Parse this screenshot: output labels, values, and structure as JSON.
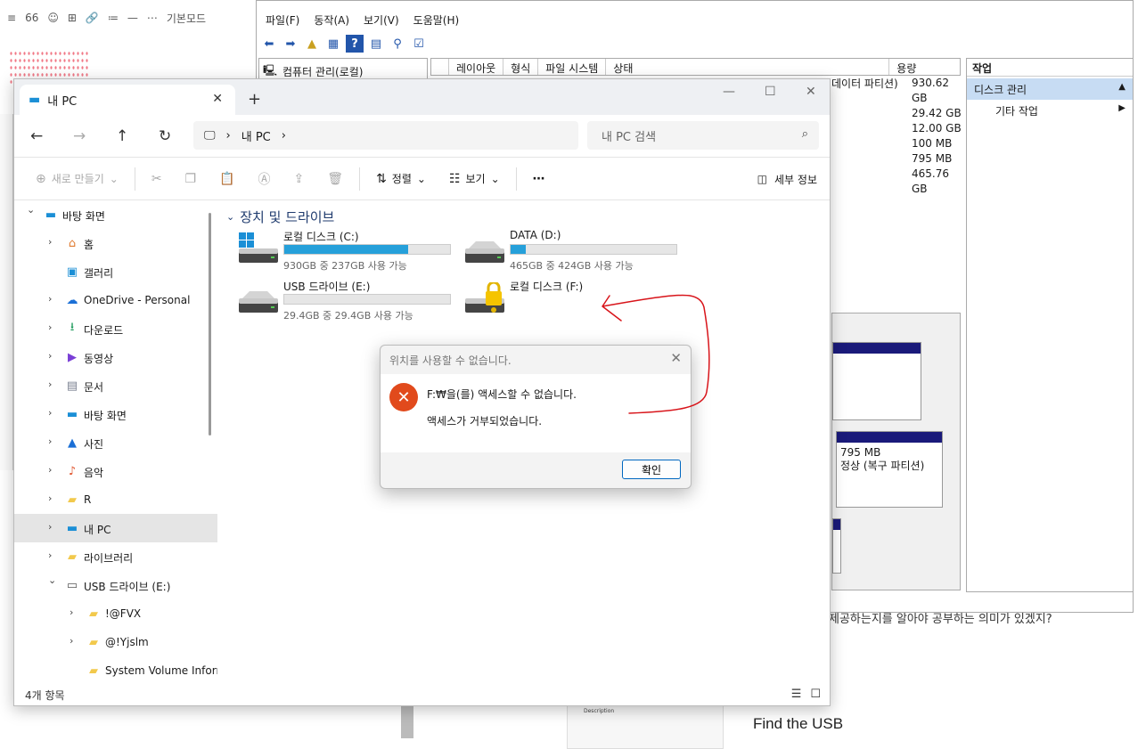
{
  "bg_editor": {
    "toolbar": [
      "≡",
      "66",
      "☺",
      "⊞",
      "🔗",
      "≔",
      "—",
      "⋯",
      "기본모드"
    ],
    "bottom_heading": "Find the USB",
    "bottom_text": "제공하는지를 알아야 공부하는 의미가 있겠지?",
    "thumb_title": "Description"
  },
  "computer_management": {
    "menu": [
      "파일(F)",
      "동작(A)",
      "보기(V)",
      "도움말(H)"
    ],
    "tree_root": "컴퓨터 관리(로컬)",
    "columns": [
      "레이아웃",
      "형식",
      "파일 시스템",
      "상태",
      "용량"
    ],
    "partition_desc": "데이터 파티션)",
    "sizes": [
      "930.62 GB",
      "29.42 GB",
      "12.00 GB",
      "100 MB",
      "795 MB",
      "465.76 GB"
    ],
    "actions_header": "작업",
    "action_selected": "디스크 관리",
    "action_sub": "기타 작업",
    "volume_size": "795 MB",
    "volume_status": "정상 (복구 파티션)"
  },
  "explorer": {
    "tab_title": "내 PC",
    "breadcrumb": "내 PC",
    "search_placeholder": "내 PC 검색",
    "commands": {
      "new": "새로 만들기",
      "sort": "정렬",
      "view": "보기",
      "more": "⋯",
      "details": "세부 정보"
    },
    "sidebar": [
      {
        "label": "바탕 화면",
        "icon": "desktop-icon",
        "glyph": "▬",
        "color": "#1b8fd6",
        "expanded": true,
        "indent": 0
      },
      {
        "label": "홈",
        "icon": "home-icon",
        "glyph": "⌂",
        "color": "#e07a2e",
        "indent": 1
      },
      {
        "label": "갤러리",
        "icon": "gallery-icon",
        "glyph": "▣",
        "color": "#1b8fd6",
        "indent": 1,
        "nochev": true
      },
      {
        "label": "OneDrive - Personal",
        "icon": "cloud-icon",
        "glyph": "☁",
        "color": "#1b6fd6",
        "indent": 1
      },
      {
        "label": "다운로드",
        "icon": "download-icon",
        "glyph": "⭳",
        "color": "#1b9a5a",
        "indent": 1
      },
      {
        "label": "동영상",
        "icon": "video-icon",
        "glyph": "▶",
        "color": "#7a3fd6",
        "indent": 1
      },
      {
        "label": "문서",
        "icon": "document-icon",
        "glyph": "▤",
        "color": "#7a8090",
        "indent": 1
      },
      {
        "label": "바탕 화면",
        "icon": "desktop-icon",
        "glyph": "▬",
        "color": "#1b8fd6",
        "indent": 1
      },
      {
        "label": "사진",
        "icon": "photo-icon",
        "glyph": "▲",
        "color": "#1b6fd6",
        "indent": 1
      },
      {
        "label": "음악",
        "icon": "music-icon",
        "glyph": "♪",
        "color": "#e0552e",
        "indent": 1
      },
      {
        "label": "R",
        "icon": "folder-icon",
        "glyph": "▰",
        "color": "#f2c94c",
        "indent": 1
      },
      {
        "label": "내 PC",
        "icon": "pc-icon",
        "glyph": "▬",
        "color": "#1b8fd6",
        "indent": 1,
        "selected": true
      },
      {
        "label": "라이브러리",
        "icon": "library-icon",
        "glyph": "▰",
        "color": "#f2c94c",
        "indent": 1
      },
      {
        "label": "USB 드라이브 (E:)",
        "icon": "usb-drive-icon",
        "glyph": "▭",
        "color": "#555",
        "indent": 1,
        "expanded": true
      },
      {
        "label": "!@FVX",
        "icon": "folder-icon",
        "glyph": "▰",
        "color": "#f2c94c",
        "indent": 2
      },
      {
        "label": "@!Yjslm",
        "icon": "folder-icon",
        "glyph": "▰",
        "color": "#f2c94c",
        "indent": 2
      },
      {
        "label": "System Volume Informati",
        "icon": "folder-icon",
        "glyph": "▰",
        "color": "#f2c94c",
        "indent": 2,
        "nochev": true
      }
    ],
    "group_title": "장치 및 드라이브",
    "drives": [
      {
        "name": "로컬 디스크 (C:)",
        "free": "930GB 중 237GB 사용 가능",
        "used_fraction": 0.745,
        "windows": true
      },
      {
        "name": "DATA (D:)",
        "free": "465GB 중 424GB 사용 가능",
        "used_fraction": 0.09
      },
      {
        "name": "USB 드라이브 (E:)",
        "free": "29.4GB 중 29.4GB 사용 가능",
        "used_fraction": 0.0
      },
      {
        "name": "로컬 디스크 (F:)",
        "locked": true
      }
    ],
    "status": "4개 항목"
  },
  "dialog": {
    "title": "위치를 사용할 수 없습니다.",
    "message": "F:₩을(를) 액세스할 수 없습니다.",
    "detail": "액세스가 거부되었습니다.",
    "ok": "확인"
  },
  "colors": {
    "accent": "#26a0da",
    "annotation": "#d8141a",
    "error": "#e14a1c"
  }
}
